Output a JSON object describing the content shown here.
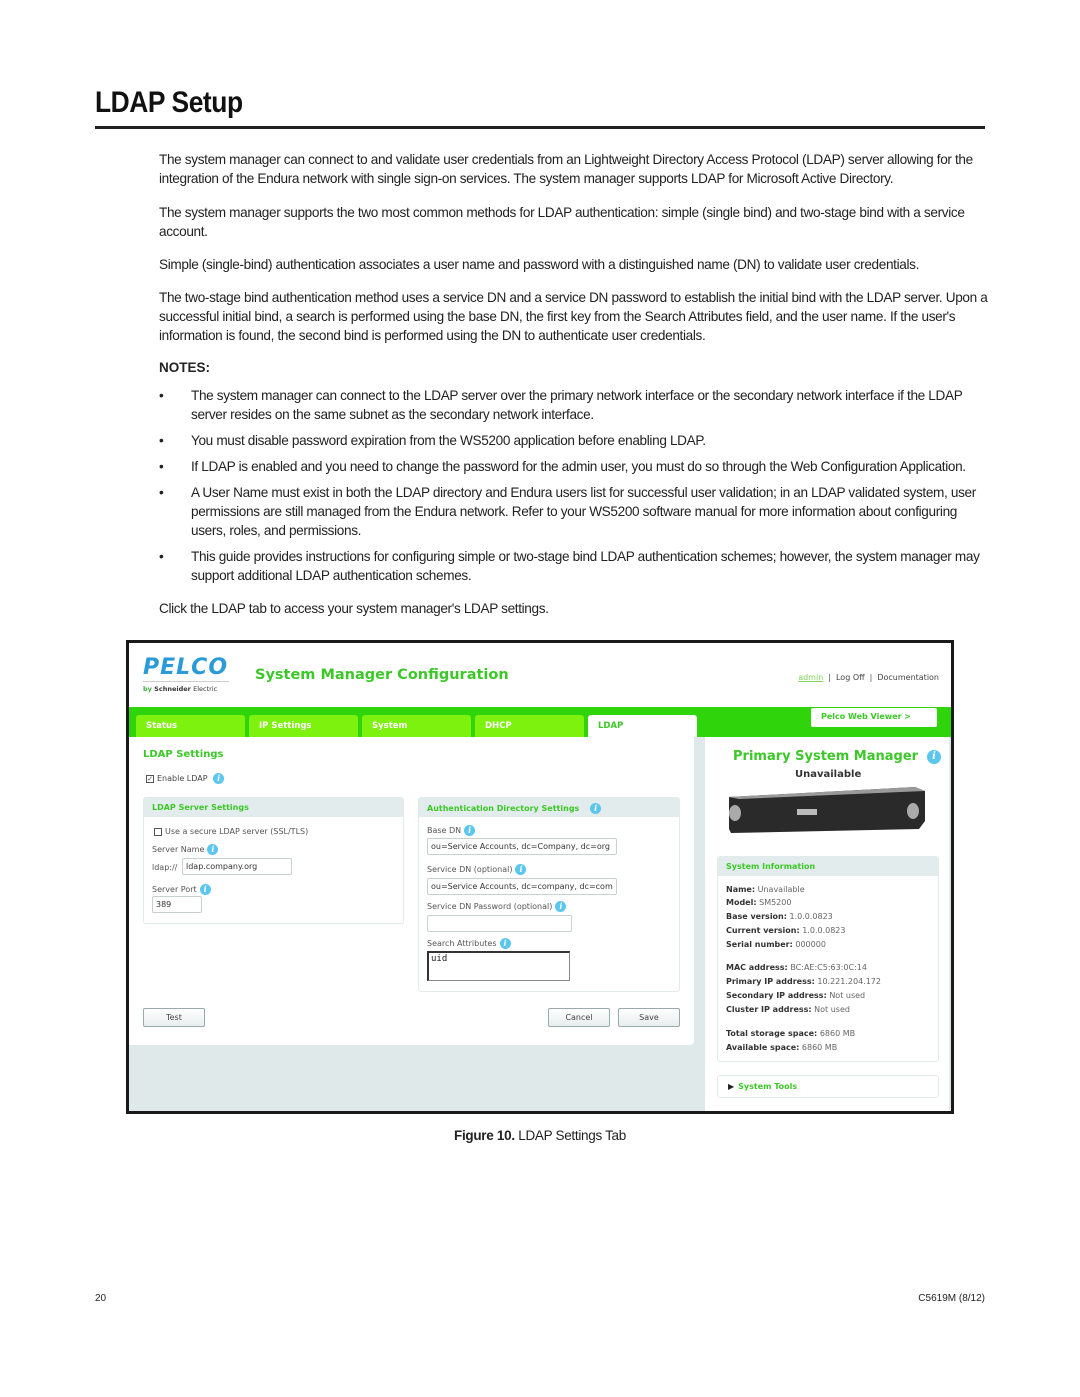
{
  "doc": {
    "title": "LDAP Setup",
    "paragraphs": [
      "The system manager can connect to and validate user credentials from an Lightweight Directory Access Protocol (LDAP) server allowing for the integration of the Endura network with single sign-on services. The system manager supports LDAP for Microsoft Active Directory.",
      "The system manager supports the two most common methods for LDAP authentication: simple (single bind) and two-stage bind with a service account.",
      "Simple (single-bind) authentication associates a user name and password with a distinguished name (DN) to validate user credentials.",
      "The two-stage bind authentication method uses a service DN and a service DN password to establish the initial bind with the LDAP server. Upon a successful initial bind, a search is performed using the base DN, the first key from the Search Attributes field, and the user name. If the user's information is found, the second bind is performed using the DN to authenticate user credentials."
    ],
    "notes_heading": "NOTES:",
    "bullet_glyph": "•",
    "notes": [
      "The system manager can connect to the LDAP server over the primary network interface or the secondary network interface if the LDAP server resides on the same subnet as the secondary network interface.",
      "You must disable password expiration from the WS5200 application before enabling LDAP.",
      "If LDAP is enabled and you need to change the password for the admin user, you must do so through the Web Configuration Application.",
      "A User Name must exist in both the LDAP directory and Endura users list for successful user validation; in an LDAP validated system, user permissions are still managed from the Endura network. Refer to your WS5200 software manual for more information about configuring users, roles, and permissions.",
      "This guide provides instructions for configuring simple or two-stage bind LDAP authentication schemes; however, the system manager may support additional LDAP authentication schemes."
    ],
    "instruction": "Click the LDAP tab to access your system manager's LDAP settings.",
    "caption_label": "Figure 10.",
    "caption_text": "LDAP Settings Tab",
    "page_number": "20",
    "doc_code": "C5619M  (8/12)"
  },
  "app": {
    "logo": "PELCO",
    "logo_by": "by",
    "logo_company": "Schneider",
    "logo_company2": "Electric",
    "title": "System Manager Configuration",
    "links": {
      "user": "admin",
      "logout": "Log Off",
      "docs": "Documentation",
      "sep": "|"
    },
    "tabs": [
      "Status",
      "IP Settings",
      "System",
      "DHCP",
      "LDAP"
    ],
    "viewer_button": "Pelco Web Viewer >",
    "info_glyph": "i",
    "ldap": {
      "section_title": "LDAP Settings",
      "enable_label": "Enable LDAP",
      "enable_checked": true,
      "server_panel": {
        "title": "LDAP Server Settings",
        "secure_label": "Use a secure LDAP server (SSL/TLS)",
        "secure_checked": false,
        "server_name_label": "Server Name",
        "prefix": "ldap://",
        "server_name": "ldap.company.org",
        "port_label": "Server Port",
        "port": "389"
      },
      "auth_panel": {
        "title": "Authentication Directory Settings",
        "base_dn_label": "Base DN",
        "base_dn": "ou=Service Accounts, dc=Company, dc=org",
        "service_dn_label": "Service DN (optional)",
        "service_dn": "ou=Service Accounts, dc=company, dc=com",
        "service_pw_label": "Service DN Password (optional)",
        "service_pw": "",
        "search_attr_label": "Search Attributes",
        "search_attr": "uid"
      },
      "buttons": {
        "test": "Test",
        "cancel": "Cancel",
        "save": "Save"
      }
    },
    "side": {
      "title": "Primary System Manager",
      "status": "Unavailable",
      "sysinfo_title": "System Information",
      "info": [
        {
          "k": "Name:",
          "v": "Unavailable"
        },
        {
          "k": "Model:",
          "v": "SM5200"
        },
        {
          "k": "Base version:",
          "v": "1.0.0.0823"
        },
        {
          "k": "Current version:",
          "v": "1.0.0.0823"
        },
        {
          "k": "Serial number:",
          "v": "000000"
        },
        {
          "k": "MAC address:",
          "v": "BC:AE:C5:63:0C:14"
        },
        {
          "k": "Primary IP address:",
          "v": "10.221.204.172"
        },
        {
          "k": "Secondary IP address:",
          "v": "Not used"
        },
        {
          "k": "Cluster IP address:",
          "v": "Not used"
        },
        {
          "k": "Total storage space:",
          "v": "6860 MB"
        },
        {
          "k": "Available space:",
          "v": "6860 MB"
        }
      ],
      "tools_label": "System Tools",
      "tools_glyph": "▶"
    },
    "colors": {
      "green": "#3cc828",
      "nav": "#2fd40a",
      "tab": "#7ef20f",
      "info": "#5bc6ee",
      "logo": "#2a9bd6"
    }
  }
}
